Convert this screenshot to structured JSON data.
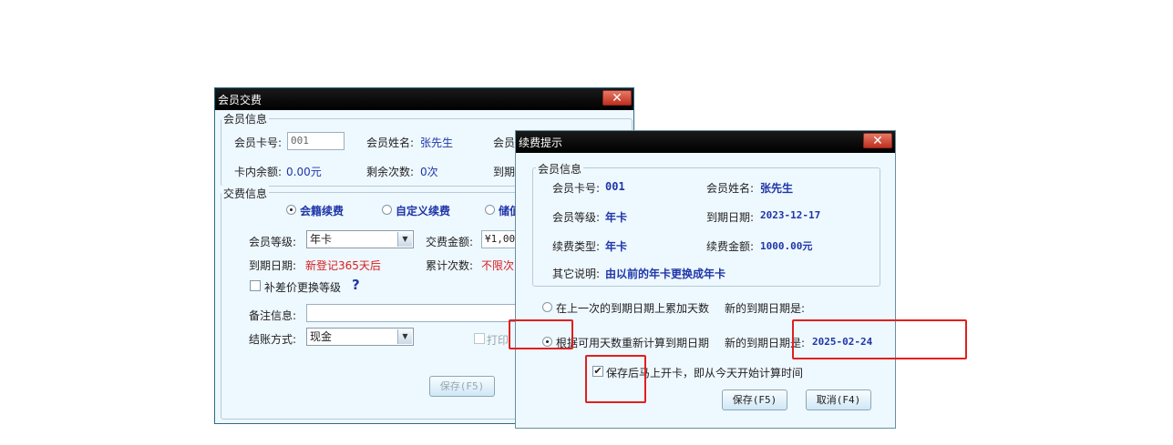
{
  "back": {
    "title": "会员交费",
    "close": "✕",
    "info_legend": "会员信息",
    "card_no_label": "会员卡号:",
    "card_no_value": "001",
    "name_label": "会员姓名:",
    "name_value": "张先生",
    "level_label_cut": "会员",
    "balance_label": "卡内余额:",
    "balance_value": "0.00元",
    "remain_label": "剩余次数:",
    "remain_value": "0次",
    "expire_label_cut": "到期",
    "pay_legend": "交费信息",
    "radio_renew": "会籍续费",
    "radio_custom": "自定义续费",
    "radio_store_cut": "储值",
    "level_label": "会员等级:",
    "level_value": "年卡",
    "amount_label": "交费金额:",
    "amount_value": "¥1,00",
    "expiry_label": "到期日期:",
    "expiry_value": "新登记365天后",
    "count_label": "累计次数:",
    "count_value": "不限次",
    "diff_label": "补差价更换等级",
    "help": "?",
    "remark_label": "备注信息:",
    "remark_value": "",
    "settle_label": "结账方式:",
    "settle_value": "现金",
    "print_cut": "打印",
    "save_button": "保存(F5)"
  },
  "front": {
    "title": "续费提示",
    "close": "✕",
    "info_legend": "会员信息",
    "card_no_label": "会员卡号:",
    "card_no_value": "001",
    "name_label": "会员姓名:",
    "name_value": "张先生",
    "level_label": "会员等级:",
    "level_value": "年卡",
    "expiry_label": "到期日期:",
    "expiry_value": "2023-12-17",
    "type_label": "续费类型:",
    "type_value": "年卡",
    "amount_label": "续费金额:",
    "amount_value": "1000.00元",
    "other_label": "其它说明:",
    "other_value": "由以前的年卡更换成年卡",
    "option1": "在上一次的到期日期上累加天数",
    "option1_new_label": "新的到期日期是:",
    "option2": "根据可用天数重新计算到期日期",
    "option2_new_label": "新的到期日期是:",
    "option2_new_value": "2025-02-24",
    "open_card_label": "保存后马上开卡，即从今天开始计算时间",
    "check_mark": "✔",
    "save_button": "保存(F5)",
    "cancel_button": "取消(F4)"
  },
  "colors": {
    "value_blue": "#1f36a8",
    "value_red": "#d81e1e",
    "highlight_red": "#e0201e"
  }
}
